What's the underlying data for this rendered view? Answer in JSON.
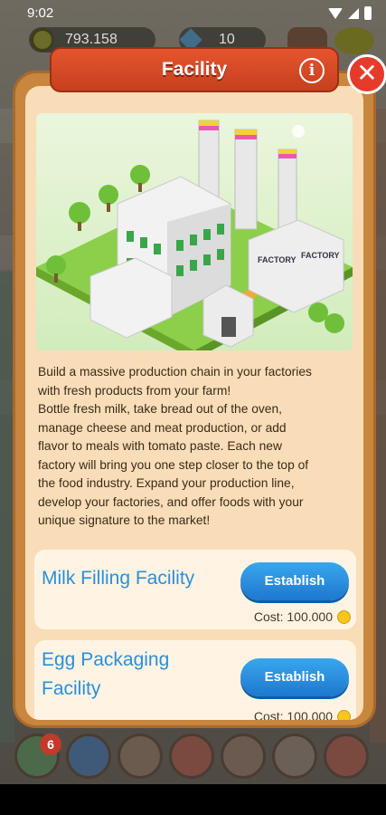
{
  "status_bar": {
    "time": "9:02",
    "icons": [
      "wifi-icon",
      "signal-icon",
      "battery-icon"
    ]
  },
  "hud": {
    "coins": "793.158",
    "gems": "10"
  },
  "modal": {
    "title": "Facility",
    "info_icon": "i",
    "close_icon": "✕",
    "illustration_labels": [
      "FACTORY",
      "FACTORY"
    ],
    "description": [
      "Build a massive production chain in your factories",
      "with fresh products from your farm!",
      "Bottle fresh milk, take bread out of the oven,",
      "manage cheese and meat production, or add",
      "flavor to meals with tomato paste. Each new",
      "factory will bring you one step closer to the top of",
      "the food industry. Expand your production line,",
      "develop your factories, and offer foods with your",
      "unique signature to the market!"
    ],
    "facilities": [
      {
        "name_lines": [
          "Milk Filling Facility"
        ],
        "button": "Establish",
        "cost": "Cost: 100.000"
      },
      {
        "name_lines": [
          "Egg Packaging",
          "Facility"
        ],
        "button": "Establish",
        "cost": "Cost: 100.000"
      }
    ]
  },
  "bottom_bar": {
    "badge": "6",
    "buttons": [
      "pencil-icon",
      "chart-icon",
      "buildings-icon",
      "farm-icon",
      "factory-icon",
      "bank-icon",
      "shop-icon"
    ]
  },
  "colors": {
    "title_red": "#d84a26",
    "button_blue": "#2b8fe0",
    "panel": "#f9ddb8",
    "frame": "#c8863e",
    "link_blue": "#2b8fd9"
  }
}
